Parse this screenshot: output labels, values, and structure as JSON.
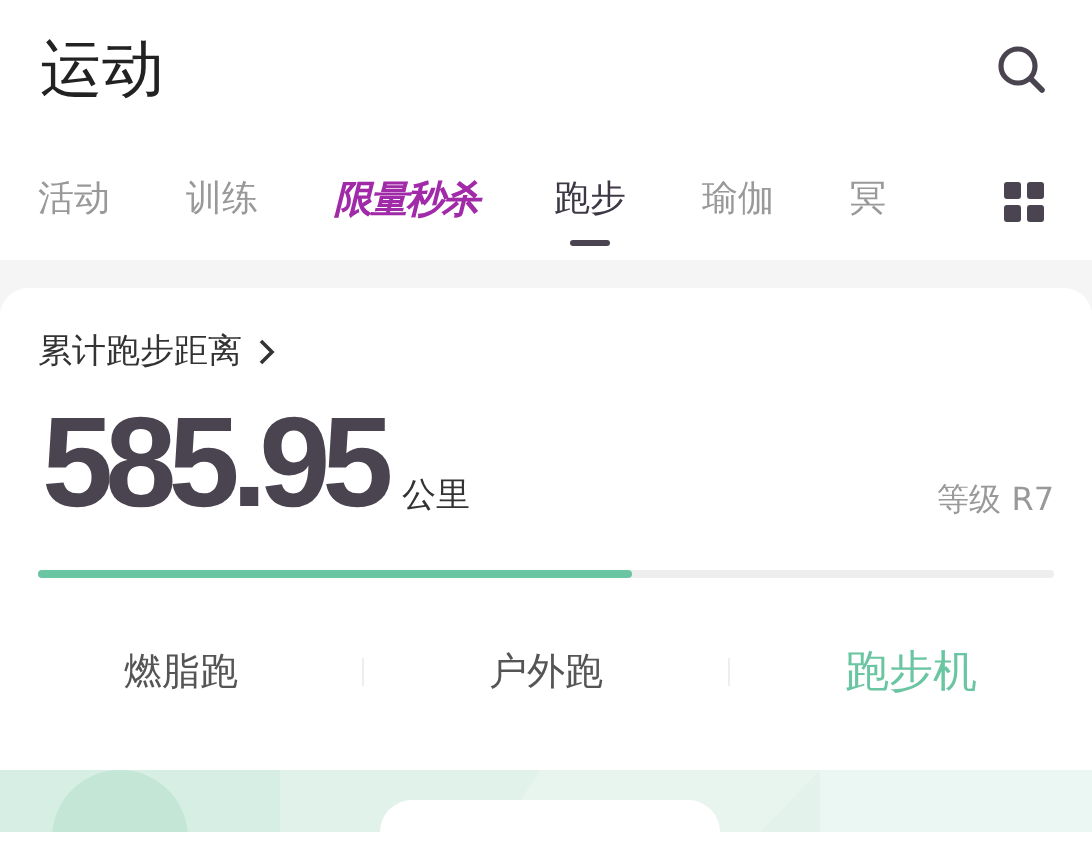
{
  "header": {
    "title": "运动"
  },
  "tabs": [
    {
      "label": "活动",
      "kind": "text",
      "selected": false
    },
    {
      "label": "训练",
      "kind": "text",
      "selected": false
    },
    {
      "label": "限量秒杀",
      "kind": "promo",
      "selected": false
    },
    {
      "label": "跑步",
      "kind": "text",
      "selected": true
    },
    {
      "label": "瑜伽",
      "kind": "text",
      "selected": false
    },
    {
      "label": "冥",
      "kind": "text",
      "selected": false
    }
  ],
  "card": {
    "title": "累计跑步距离",
    "distance": "585.95",
    "unit": "公里",
    "grade": "等级 R7",
    "level": 0.585
  },
  "modes": [
    {
      "label": "燃脂跑",
      "selected": false
    },
    {
      "label": "户外跑",
      "selected": false
    },
    {
      "label": "跑步机",
      "selected": true
    }
  ]
}
